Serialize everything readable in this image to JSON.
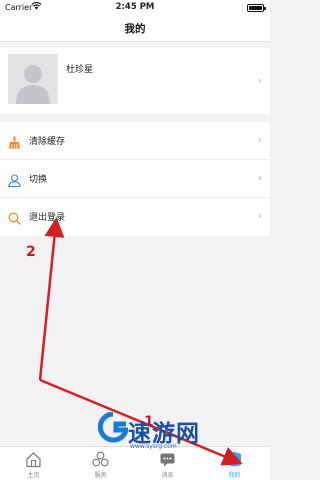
{
  "status_bar": {
    "carrier": "Carrier",
    "time": "2:45 PM"
  },
  "nav": {
    "title": "我的"
  },
  "profile": {
    "name": "杜珍星"
  },
  "menu": [
    {
      "label": "清除缓存",
      "icon": "broom-icon",
      "icon_color": "#f08b2e"
    },
    {
      "label": "切换",
      "icon": "user-icon",
      "icon_color": "#3a88d6"
    },
    {
      "label": "退出登录",
      "icon": "search-icon",
      "icon_color": "#f08b2e"
    }
  ],
  "tabs": [
    {
      "label": "主页",
      "icon": "home-icon",
      "active": false
    },
    {
      "label": "服务",
      "icon": "services-icon",
      "active": false
    },
    {
      "label": "消息",
      "icon": "message-icon",
      "active": false
    },
    {
      "label": "我的",
      "icon": "profile-icon",
      "active": true
    }
  ],
  "watermark": {
    "text": "速游网",
    "url": "www.sysrg.com"
  },
  "annotations": {
    "marker_1": "1",
    "marker_2": "2",
    "arrow_color": "#d42020"
  },
  "colors": {
    "accent": "#3aa0ff",
    "watermark": "#1a4fa3"
  }
}
